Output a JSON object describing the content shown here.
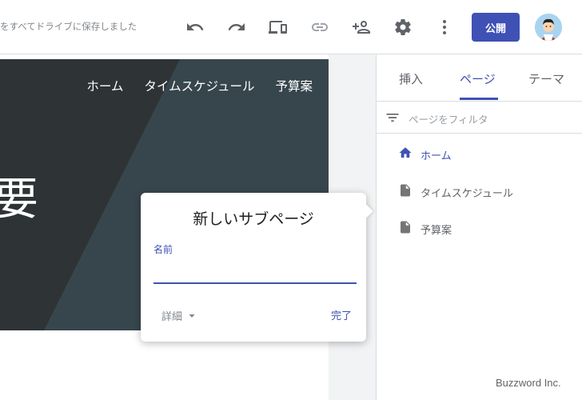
{
  "topbar": {
    "save_status": "をすべてドライブに保存しました",
    "publish_label": "公開",
    "icons": [
      "undo-icon",
      "redo-icon",
      "preview-devices-icon",
      "link-icon",
      "share-add-person-icon",
      "gear-icon",
      "more-vert-icon"
    ]
  },
  "site": {
    "nav": [
      "ホーム",
      "タイムスケジュール",
      "予算案"
    ],
    "hero_text": "要"
  },
  "panel": {
    "tabs": [
      "挿入",
      "ページ",
      "テーマ"
    ],
    "active_tab": "ページ",
    "filter_placeholder": "ページをフィルタ",
    "pages": [
      {
        "label": "ホーム",
        "icon": "home-icon",
        "active": true
      },
      {
        "label": "タイムスケジュール",
        "icon": "page-icon",
        "active": false
      },
      {
        "label": "予算案",
        "icon": "page-icon",
        "active": false
      }
    ]
  },
  "dialog": {
    "title": "新しいサブページ",
    "name_label": "名前",
    "name_value": "",
    "details_label": "詳細",
    "done_label": "完了"
  },
  "brand": "Buzzword Inc.",
  "colors": {
    "accent": "#3f51b5",
    "hero_bg": "#2f3a3f"
  }
}
